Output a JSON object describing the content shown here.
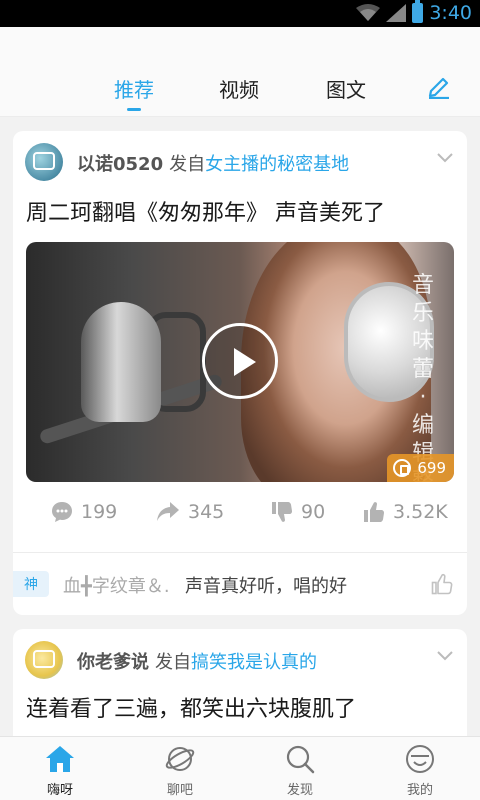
{
  "status_bar": {
    "time": "3:40"
  },
  "tabs": [
    {
      "label": "推荐",
      "active": true
    },
    {
      "label": "视频",
      "active": false
    },
    {
      "label": "图文",
      "active": false
    }
  ],
  "accent_color": "#2aa6e8",
  "posts": [
    {
      "user": "以诺0520",
      "from_text": "发自",
      "group": "女主播的秘密基地",
      "title": "周二珂翻唱《匆匆那年》 声音美死了",
      "video": {
        "watermark": "音乐味蕾·编辑整",
        "views": "699"
      },
      "stats": {
        "comments": "199",
        "shares": "345",
        "dislikes": "90",
        "likes": "3.52K"
      },
      "hot_comment": {
        "badge": "神",
        "user": "血╋字纹章＆.",
        "text": "声音真好听，唱的好"
      }
    },
    {
      "user": "你老爹说",
      "from_text": "发自",
      "group": "搞笑我是认真的",
      "title": "连着看了三遍，都笑出六块腹肌了"
    }
  ],
  "bottom_nav": [
    {
      "label": "嗨呀",
      "icon": "home-icon",
      "active": true
    },
    {
      "label": "聊吧",
      "icon": "planet-icon",
      "active": false
    },
    {
      "label": "发现",
      "icon": "search-icon",
      "active": false
    },
    {
      "label": "我的",
      "icon": "smiley-icon",
      "active": false
    }
  ]
}
